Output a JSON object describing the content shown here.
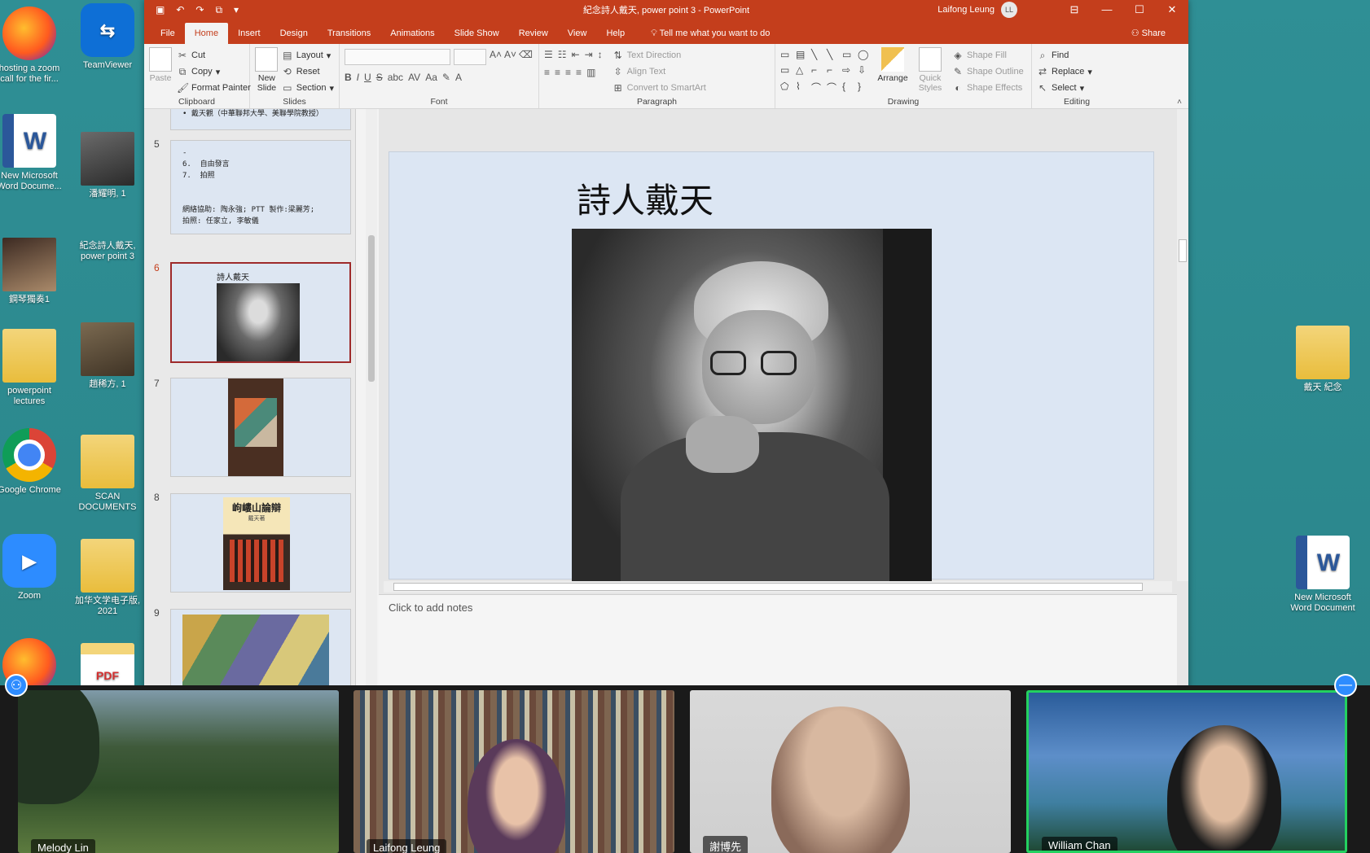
{
  "window": {
    "title": "紀念詩人戴天, power point 3  -  PowerPoint",
    "user_name": "Laifong Leung",
    "user_initials": "LL"
  },
  "tabs": [
    "File",
    "Home",
    "Insert",
    "Design",
    "Transitions",
    "Animations",
    "Slide Show",
    "Review",
    "View",
    "Help"
  ],
  "tell_me": "Tell me what you want to do",
  "share_label": "Share",
  "ribbon": {
    "clipboard": {
      "paste": "Paste",
      "cut": "Cut",
      "copy": "Copy",
      "format_painter": "Format Painter",
      "name": "Clipboard"
    },
    "slides": {
      "new_slide": "New Slide",
      "layout": "Layout",
      "reset": "Reset",
      "section": "Section",
      "name": "Slides"
    },
    "font": {
      "name": "Font"
    },
    "paragraph": {
      "text_direction": "Text Direction",
      "align_text": "Align Text",
      "convert_smartart": "Convert to SmartArt",
      "name": "Paragraph"
    },
    "drawing": {
      "arrange": "Arrange",
      "quick_styles": "Quick Styles",
      "shape_fill": "Shape Fill",
      "shape_outline": "Shape Outline",
      "shape_effects": "Shape Effects",
      "name": "Drawing"
    },
    "editing": {
      "find": "Find",
      "replace": "Replace",
      "select": "Select",
      "name": "Editing"
    }
  },
  "thumbnails": [
    {
      "num": "",
      "text": "• 戴天觀（中華聯邦大學、美聯學院教授）"
    },
    {
      "num": "5",
      "text": "-\n6.  自由發言\n7.  拍照\n\n\n網絡協助: 陶永強; PTT 製作:梁麗芳;\n拍照: 任家立, 李敏儀"
    },
    {
      "num": "6",
      "title": "詩人戴天"
    },
    {
      "num": "7"
    },
    {
      "num": "8",
      "book_title": "岣嶁山論辯",
      "book_author": "戴天著"
    },
    {
      "num": "9"
    }
  ],
  "slide": {
    "title": "詩人戴天"
  },
  "notes_placeholder": "Click to add notes",
  "desktop_icons": [
    {
      "label": "hosting a zoom call for the fir..."
    },
    {
      "label": "TeamViewer"
    },
    {
      "label": "New Microsoft Word Docume..."
    },
    {
      "label": "潘耀明, 1"
    },
    {
      "label": "鋼琴獨奏1"
    },
    {
      "label": "紀念詩人戴天, power point 3"
    },
    {
      "label": "powerpoint lectures"
    },
    {
      "label": "趙稀方, 1"
    },
    {
      "label": "Google Chrome"
    },
    {
      "label": "SCAN DOCUMENTS"
    },
    {
      "label": "Zoom"
    },
    {
      "label": "加华文学电子版, 2021"
    },
    {
      "label": "戴天 紀念"
    },
    {
      "label": "New Microsoft Word Document"
    }
  ],
  "participants": [
    {
      "name": "Melody Lin"
    },
    {
      "name": "Laifong Leung"
    },
    {
      "name": "謝博先"
    },
    {
      "name": "William Chan"
    }
  ]
}
